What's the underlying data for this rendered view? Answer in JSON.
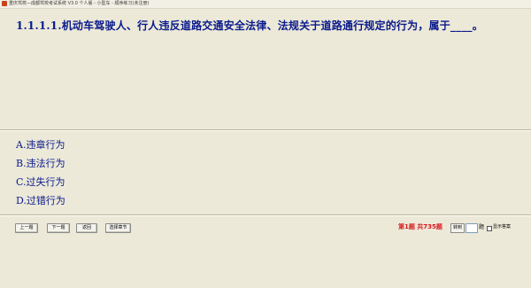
{
  "window": {
    "title": "重庆驾校—成都驾校考试系统 V3.0 个人版 - 小型车 - 顺序练习(未注册)"
  },
  "question": {
    "text": "1.1.1.1.机动车驾驶人、行人违反道路交通安全法律、法规关于道路通行规定的行为，属于____。"
  },
  "options": [
    {
      "label": "A.违章行为"
    },
    {
      "label": "B.违法行为"
    },
    {
      "label": "C.过失行为"
    },
    {
      "label": "D.过错行为"
    }
  ],
  "toolbar": {
    "prev_label": "上一题",
    "next_label": "下一题",
    "back_label": "返回",
    "chapter_label": "选择章节"
  },
  "status": {
    "text": "第1题 共735题"
  },
  "jump": {
    "button_label": "转到",
    "input_value": "",
    "unit": "题"
  },
  "show_answer": {
    "label": "显示答案",
    "checked": false
  },
  "colors": {
    "background": "#ece9d8",
    "text_blue": "#0a1a8c",
    "status_red": "#d8161b"
  }
}
